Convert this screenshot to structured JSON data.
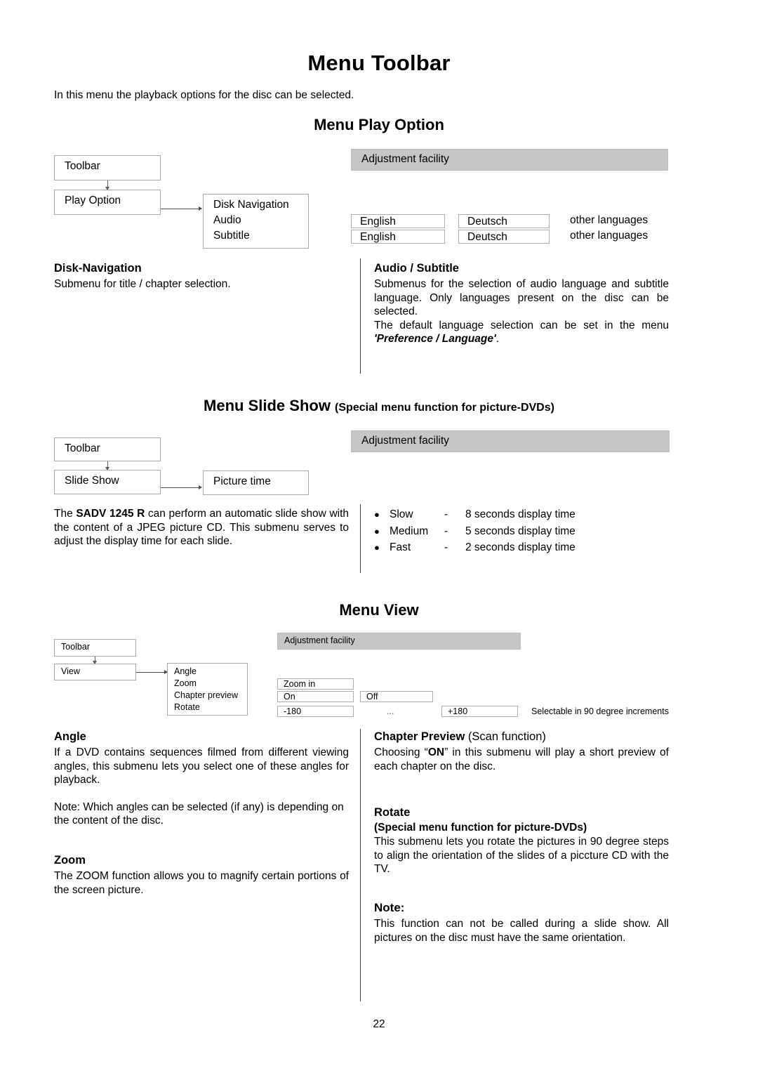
{
  "document": {
    "title": "Menu Toolbar",
    "intro": "In this menu the playback options for the disc can be selected.",
    "page_number": "22"
  },
  "play_option": {
    "heading": "Menu Play Option",
    "diagram": {
      "box_toolbar": "Toolbar",
      "box_play_option": "Play Option",
      "box_submenu": "Disk Navigation\nAudio\nSubtitle",
      "submenu_lines": [
        "Disk Navigation",
        "Audio",
        "Subtitle"
      ],
      "adjustment_band": "Adjustment facility",
      "audio_row": {
        "option1": "English",
        "option2": "Deutsch",
        "option3": "other languages"
      },
      "subtitle_row": {
        "option1": "English",
        "option2": "Deutsch",
        "option3": "other languages"
      }
    },
    "left_section": {
      "title": "Disk-Navigation",
      "body": "Submenu for title / chapter selection."
    },
    "right_section": {
      "title": "Audio / Subtitle",
      "para1": "Submenus for the selection of audio language and subtitle language. Only languages present on the disc can be selected.",
      "para2_prefix": "The default language selection can be set in the menu ",
      "para2_emphasis": "'Preference / Language'",
      "para2_suffix": "."
    }
  },
  "slide_show": {
    "heading_main": "Menu Slide Show ",
    "heading_sub": "(Special menu function for picture-DVDs)",
    "diagram": {
      "box_toolbar": "Toolbar",
      "box_slide_show": "Slide Show",
      "box_picture_time": "Picture time",
      "adjustment_band": "Adjustment facility"
    },
    "left_text": {
      "prefix": "The ",
      "bold_model": "SADV 1245 R",
      "suffix": " can perform an automatic slide show with the content of a JPEG picture CD. This submenu serves to adjust the display time for each slide."
    },
    "bullets": [
      {
        "name": "Slow",
        "dash": "-",
        "value": "8 seconds display time"
      },
      {
        "name": "Medium",
        "dash": "-",
        "value": "5 seconds display time"
      },
      {
        "name": "Fast",
        "dash": "-",
        "value": "2 seconds display time"
      }
    ]
  },
  "view": {
    "heading": "Menu View",
    "diagram": {
      "box_toolbar": "Toolbar",
      "box_view": "View",
      "submenu_lines": [
        "Angle",
        "Zoom",
        "Chapter preview",
        "Rotate"
      ],
      "adjustment_band": "Adjustment facility",
      "zoom_row": {
        "option1": "Zoom in"
      },
      "chapter_row": {
        "option1": "On",
        "option2": "Off"
      },
      "rotate_row": {
        "option1": "-180",
        "ellipsis": "...",
        "option2": "+180",
        "note": "Selectable in 90 degree increments"
      }
    },
    "angle": {
      "title": "Angle",
      "para1": "If a DVD contains sequences filmed from different viewing angles, this submenu lets you select one of these angles for playback.",
      "para2": "Note: Which angles can be selected (if any) is depending on the content of the disc."
    },
    "zoom": {
      "title": "Zoom",
      "para1": "The ZOOM function allows you to magnify certain portions of the screen picture."
    },
    "chapter_preview": {
      "title_bold": "Chapter Preview ",
      "title_light": "(Scan function)",
      "para_prefix": "Choosing “",
      "para_bold": "ON",
      "para_suffix": "” in this submenu will play a short preview of each chapter on the disc."
    },
    "rotate": {
      "title": "Rotate",
      "subtitle": "(Special menu function for picture-DVDs)",
      "para1": "This submenu lets you rotate the pictures in 90 degree steps to align the orientation of the slides of a piccture CD with the TV."
    },
    "note": {
      "title": "Note:",
      "para1": "This function can not be called during a slide show. All pictures on the disc must have the same orientation."
    }
  }
}
